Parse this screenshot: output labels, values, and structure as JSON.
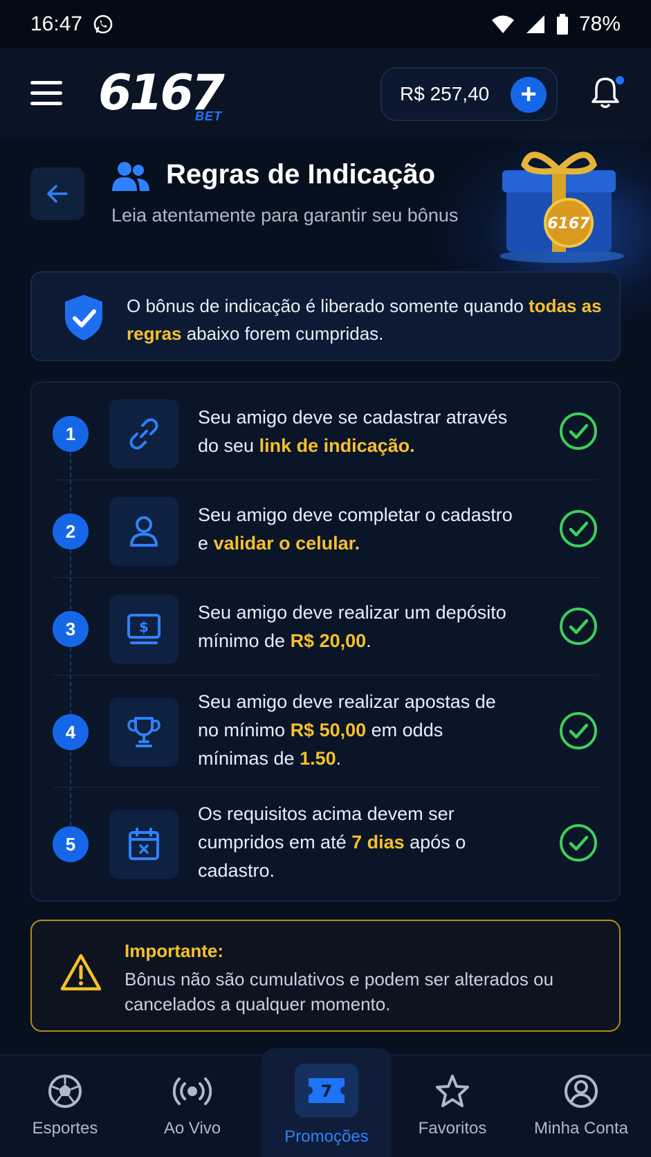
{
  "status_bar": {
    "time": "16:47",
    "battery": "78%",
    "icons": [
      "whatsapp-icon",
      "wifi-icon",
      "signal-icon",
      "battery-icon"
    ]
  },
  "header": {
    "logo_main": "6167",
    "logo_sub": "BET",
    "balance": "R$ 257,40",
    "add_label": "+"
  },
  "page": {
    "title": "Regras de Indicação",
    "subtitle": "Leia atentamente para garantir seu bônus",
    "gift_badge": "6167"
  },
  "info": {
    "text_before": "O bônus de indicação é liberado somente quando ",
    "highlight": "todas as regras",
    "text_after": " abaixo forem cumpridas."
  },
  "rules": [
    {
      "num": "1",
      "icon": "link-icon",
      "parts": [
        "Seu amigo deve se cadastrar através do seu ",
        "link de indicação.",
        ""
      ]
    },
    {
      "num": "2",
      "icon": "user-icon",
      "parts": [
        "Seu amigo deve completar o cadastro e ",
        "validar o celular.",
        ""
      ]
    },
    {
      "num": "3",
      "icon": "deposit-icon",
      "parts": [
        "Seu amigo deve realizar um depósito mínimo de ",
        "R$ 20,00",
        "."
      ]
    },
    {
      "num": "4",
      "icon": "trophy-icon",
      "parts": [
        "Seu amigo deve realizar apostas de no mínimo ",
        "R$ 50,00",
        " em odds mínimas de ",
        "1.50",
        "."
      ]
    },
    {
      "num": "5",
      "icon": "calendar-icon",
      "parts": [
        "Os requisitos acima devem ser cumpridos em até ",
        "7 dias",
        " após o cadastro."
      ]
    }
  ],
  "important": {
    "title": "Importante:",
    "text": "Bônus não são cumulativos e podem ser alterados ou cancelados a qualquer momento."
  },
  "nav": [
    {
      "label": "Esportes",
      "icon": "soccer-ball-icon"
    },
    {
      "label": "Ao Vivo",
      "icon": "live-broadcast-icon"
    },
    {
      "label": "Promoções",
      "icon": "promo-ticket-icon",
      "badge": "7",
      "active": true
    },
    {
      "label": "Favoritos",
      "icon": "star-icon"
    },
    {
      "label": "Minha Conta",
      "icon": "account-icon"
    }
  ],
  "colors": {
    "accent": "#1667e8",
    "highlight": "#f7c02a",
    "success": "#3ccf5a",
    "background": "#07101f"
  }
}
